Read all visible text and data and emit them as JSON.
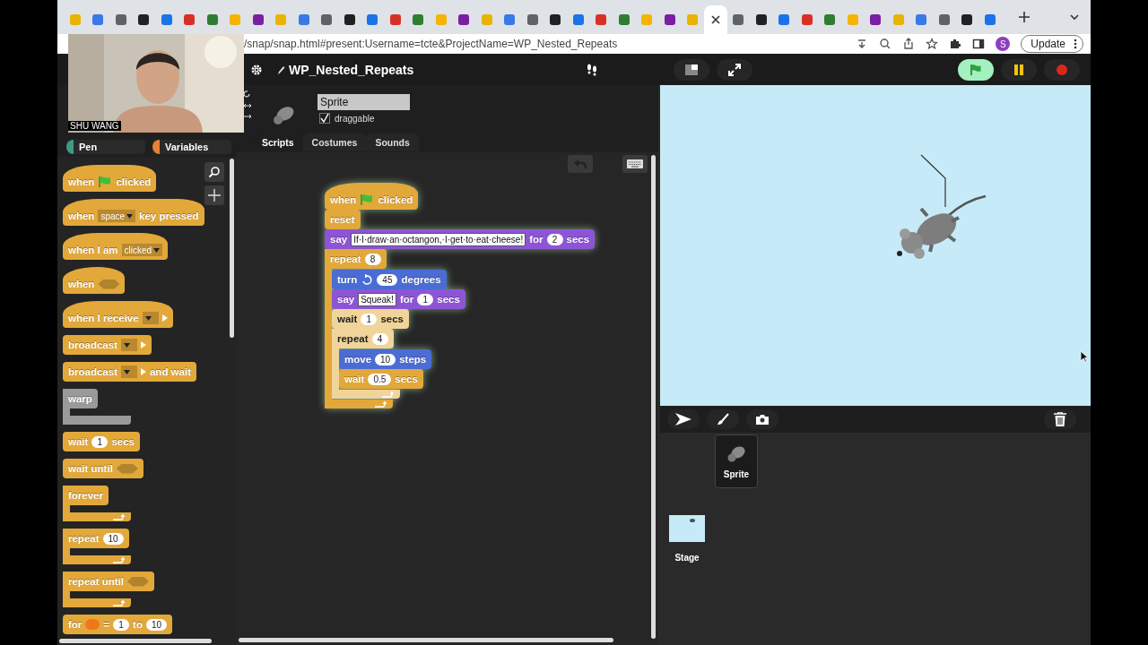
{
  "browser": {
    "tabs": [
      {
        "selected": false
      },
      {
        "selected": false
      },
      {
        "selected": false
      },
      {
        "selected": false
      },
      {
        "selected": false
      },
      {
        "selected": false
      },
      {
        "selected": false
      },
      {
        "selected": false
      },
      {
        "selected": false
      },
      {
        "selected": false
      },
      {
        "selected": false
      },
      {
        "selected": false
      },
      {
        "selected": false
      },
      {
        "selected": false
      },
      {
        "selected": false
      },
      {
        "selected": false
      },
      {
        "selected": false
      },
      {
        "selected": false
      },
      {
        "selected": false
      },
      {
        "selected": false
      },
      {
        "selected": false
      },
      {
        "selected": false
      },
      {
        "selected": false
      },
      {
        "selected": false
      },
      {
        "selected": false
      },
      {
        "selected": false
      },
      {
        "selected": false
      },
      {
        "selected": false
      },
      {
        "selected": true
      },
      {
        "selected": false
      },
      {
        "selected": false
      },
      {
        "selected": false
      },
      {
        "selected": false
      },
      {
        "selected": false
      },
      {
        "selected": false
      },
      {
        "selected": false
      },
      {
        "selected": false
      },
      {
        "selected": false
      },
      {
        "selected": false
      },
      {
        "selected": false
      },
      {
        "selected": false
      }
    ],
    "address": "/snap/snap.html#present:Username=tcte&ProjectName=WP_Nested_Repeats",
    "profile": "S",
    "update_button": "Update"
  },
  "webcam": {
    "kind": "picture",
    "name": "SHU WANG"
  },
  "snap": {
    "project_title": "WP_Nested_Repeats"
  },
  "categories": [
    {
      "label": "Pen",
      "color": "#3e9c84"
    },
    {
      "label": "Variables",
      "color": "#e8823a"
    }
  ],
  "palette": [
    {
      "kind": "hat",
      "color": "#e2a83a",
      "parts": [
        {
          "kind": "text",
          "text": "when"
        },
        {
          "kind": "flag"
        },
        {
          "kind": "text",
          "text": "clicked"
        }
      ]
    },
    {
      "kind": "hat",
      "color": "#e2a83a",
      "parts": [
        {
          "kind": "text",
          "text": "when"
        },
        {
          "kind": "dropdown",
          "text": "space"
        },
        {
          "kind": "text",
          "text": "key pressed"
        }
      ]
    },
    {
      "kind": "hat",
      "color": "#e2a83a",
      "parts": [
        {
          "kind": "text",
          "text": "when I am"
        },
        {
          "kind": "dropdown",
          "text": "clicked"
        }
      ]
    },
    {
      "kind": "hat",
      "color": "#e2a83a",
      "parts": [
        {
          "kind": "text",
          "text": "when"
        },
        {
          "kind": "bool"
        }
      ]
    },
    {
      "kind": "hat",
      "color": "#e2a83a",
      "parts": [
        {
          "kind": "text",
          "text": "when I receive"
        },
        {
          "kind": "dropdown"
        },
        {
          "kind": "arrow"
        }
      ]
    },
    {
      "kind": "command",
      "color": "#e2a83a",
      "parts": [
        {
          "kind": "text",
          "text": "broadcast"
        },
        {
          "kind": "dropdown"
        },
        {
          "kind": "arrow"
        }
      ]
    },
    {
      "kind": "command",
      "color": "#e2a83a",
      "parts": [
        {
          "kind": "text",
          "text": "broadcast"
        },
        {
          "kind": "dropdown"
        },
        {
          "kind": "arrow"
        },
        {
          "kind": "text",
          "text": "and wait"
        }
      ]
    },
    {
      "kind": "c",
      "color": "#9a9a9a",
      "parts": [
        {
          "kind": "text",
          "text": "warp"
        }
      ]
    },
    {
      "kind": "command",
      "color": "#e2a83a",
      "parts": [
        {
          "kind": "text",
          "text": "wait"
        },
        {
          "kind": "slot",
          "text": "1"
        },
        {
          "kind": "text",
          "text": "secs"
        }
      ]
    },
    {
      "kind": "command",
      "color": "#e2a83a",
      "parts": [
        {
          "kind": "text",
          "text": "wait until"
        },
        {
          "kind": "bool"
        }
      ]
    },
    {
      "kind": "c",
      "color": "#e2a83a",
      "loop": true,
      "parts": [
        {
          "kind": "text",
          "text": "forever"
        }
      ]
    },
    {
      "kind": "c",
      "color": "#e2a83a",
      "loop": true,
      "parts": [
        {
          "kind": "text",
          "text": "repeat"
        },
        {
          "kind": "slot",
          "text": "10"
        }
      ]
    },
    {
      "kind": "c",
      "color": "#e2a83a",
      "loop": true,
      "parts": [
        {
          "kind": "text",
          "text": "repeat until"
        },
        {
          "kind": "bool"
        }
      ]
    },
    {
      "kind": "command",
      "color": "#e2a83a",
      "parts": [
        {
          "kind": "text",
          "text": "for"
        },
        {
          "kind": "var"
        },
        {
          "kind": "text",
          "text": "="
        },
        {
          "kind": "slot",
          "text": "1"
        },
        {
          "kind": "text",
          "text": "to"
        },
        {
          "kind": "slot",
          "text": "10"
        }
      ]
    }
  ],
  "sprite": {
    "name": "Sprite",
    "draggable": {
      "label": "draggable",
      "checked": true
    }
  },
  "tabs": [
    {
      "label": "Scripts",
      "selected": true
    },
    {
      "label": "Costumes",
      "selected": false
    },
    {
      "label": "Sounds",
      "selected": false
    }
  ],
  "script": [
    {
      "kind": "hat",
      "color": "#e2a83a",
      "parts": [
        {
          "kind": "text",
          "text": "when"
        },
        {
          "kind": "flag"
        },
        {
          "kind": "text",
          "text": "clicked"
        }
      ]
    },
    {
      "kind": "command",
      "color": "#e2a83a",
      "parts": [
        {
          "kind": "text",
          "text": "reset"
        }
      ]
    },
    {
      "kind": "command",
      "color": "#8d55d6",
      "parts": [
        {
          "kind": "text",
          "text": "say"
        },
        {
          "kind": "textslot",
          "text": "If·I·draw·an·octangon,·I·get·to·eat·cheese!"
        },
        {
          "kind": "text",
          "text": "for"
        },
        {
          "kind": "slot",
          "text": "2"
        },
        {
          "kind": "text",
          "text": "secs"
        }
      ]
    },
    {
      "kind": "c",
      "color": "#e2a83a",
      "loop": true,
      "parts": [
        {
          "kind": "text",
          "text": "repeat"
        },
        {
          "kind": "slot",
          "text": "8"
        }
      ],
      "children": [
        {
          "kind": "command",
          "color": "#4a6cd4",
          "parts": [
            {
              "kind": "text",
              "text": "turn"
            },
            {
              "kind": "rotate"
            },
            {
              "kind": "slot",
              "text": "45"
            },
            {
              "kind": "text",
              "text": "degrees"
            }
          ]
        },
        {
          "kind": "command",
          "color": "#8d55d6",
          "parts": [
            {
              "kind": "text",
              "text": "say"
            },
            {
              "kind": "textslot",
              "text": "Squeak!"
            },
            {
              "kind": "text",
              "text": "for"
            },
            {
              "kind": "slot",
              "text": "1"
            },
            {
              "kind": "text",
              "text": "secs"
            }
          ]
        },
        {
          "kind": "command",
          "color": "#f0d49a",
          "zebra": true,
          "parts": [
            {
              "kind": "text",
              "text": "wait"
            },
            {
              "kind": "slot",
              "text": "1"
            },
            {
              "kind": "text",
              "text": "secs"
            }
          ]
        },
        {
          "kind": "c",
          "color": "#f0d49a",
          "zebra": true,
          "loop": true,
          "parts": [
            {
              "kind": "text",
              "text": "repeat"
            },
            {
              "kind": "slot",
              "text": "4"
            }
          ],
          "children": [
            {
              "kind": "command",
              "color": "#4a6cd4",
              "parts": [
                {
                  "kind": "text",
                  "text": "move"
                },
                {
                  "kind": "slot",
                  "text": "10"
                },
                {
                  "kind": "text",
                  "text": "steps"
                }
              ]
            },
            {
              "kind": "command",
              "color": "#e2a83a",
              "parts": [
                {
                  "kind": "text",
                  "text": "wait"
                },
                {
                  "kind": "slot",
                  "text": "0.5"
                },
                {
                  "kind": "text",
                  "text": "secs"
                }
              ]
            }
          ]
        }
      ]
    }
  ],
  "corral": {
    "sprites": [
      {
        "label": "Sprite",
        "selected": true
      }
    ],
    "stage": {
      "label": "Stage"
    }
  }
}
